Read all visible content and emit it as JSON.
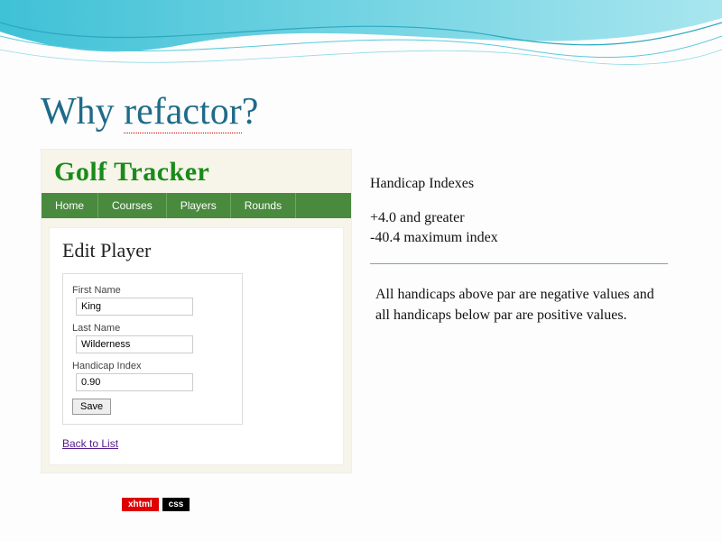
{
  "slide": {
    "title_word1": "Why ",
    "title_word2": "refactor",
    "title_word3": "?"
  },
  "app": {
    "logo": "Golf Tracker",
    "nav": [
      "Home",
      "Courses",
      "Players",
      "Rounds"
    ],
    "heading": "Edit Player",
    "form": {
      "first_name_label": "First Name",
      "first_name_value": "King",
      "last_name_label": "Last Name",
      "last_name_value": "Wilderness",
      "handicap_label": "Handicap Index",
      "handicap_value": "0.90",
      "save_label": "Save"
    },
    "back_link": "Back to List",
    "badges": {
      "xhtml": "xhtml",
      "css": "css"
    }
  },
  "notes": {
    "heading": "Handicap Indexes",
    "line1": "+4.0 and greater",
    "line2": "-40.4 maximum index",
    "explain": "All handicaps above par are negative values and all handicaps below par are positive values."
  }
}
